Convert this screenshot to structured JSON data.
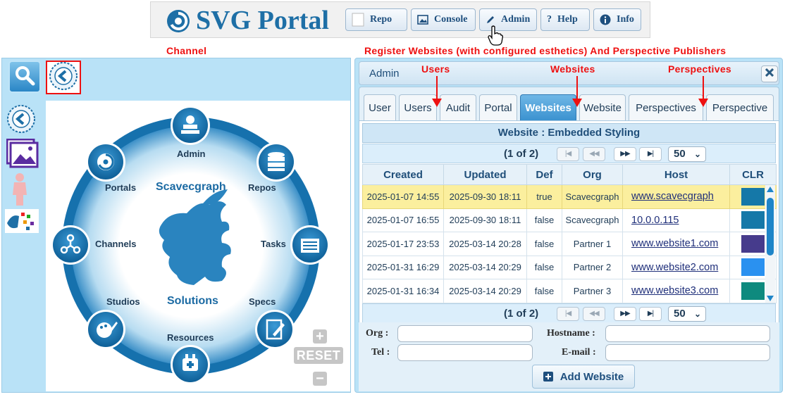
{
  "topbar": {
    "brand": "SVG Portal",
    "buttons": {
      "repo": "Repo",
      "console": "Console",
      "admin": "Admin",
      "help": "Help",
      "info": "Info"
    }
  },
  "annotations": {
    "channel": "Channel",
    "register": "Register Websites (with configured esthetics) And Perspective Publishers",
    "users": "Users",
    "websites": "Websites",
    "perspectives": "Perspectives"
  },
  "wheel": {
    "center_top": "Scavecgraph",
    "center_bottom": "Solutions",
    "nodes": {
      "admin": "Admin",
      "repos": "Repos",
      "tasks": "Tasks",
      "specs": "Specs",
      "resources": "Resources",
      "studios": "Studios",
      "channels": "Channels",
      "portals": "Portals"
    },
    "reset": "RESET"
  },
  "admin": {
    "title": "Admin",
    "tabs": [
      "User",
      "Users",
      "Audit",
      "Portal",
      "Websites",
      "Website",
      "Perspectives",
      "Perspective"
    ],
    "active_tab": "Websites",
    "grid": {
      "caption": "Website : Embedded Styling",
      "pager_info": "(1 of 2)",
      "page_size": "50",
      "columns": [
        "Created",
        "Updated",
        "Def",
        "Org",
        "Host",
        "CLR"
      ],
      "rows": [
        {
          "created": "2025-01-07 14:55",
          "updated": "2025-09-30 18:11",
          "def": "true",
          "org": "Scavecgraph",
          "host": "www.scavecgraph",
          "clr": "#1578a8"
        },
        {
          "created": "2025-01-07 16:55",
          "updated": "2025-09-30 18:11",
          "def": "false",
          "org": "Scavecgraph",
          "host": "10.0.0.115",
          "clr": "#1578a8"
        },
        {
          "created": "2025-01-17 23:53",
          "updated": "2025-03-14 20:28",
          "def": "false",
          "org": "Partner 1",
          "host": "www.website1.com",
          "clr": "#463b8c"
        },
        {
          "created": "2025-01-31 16:29",
          "updated": "2025-03-14 20:29",
          "def": "false",
          "org": "Partner 2",
          "host": "www.website2.com",
          "clr": "#2a91f0"
        },
        {
          "created": "2025-01-31 16:34",
          "updated": "2025-03-14 20:29",
          "def": "false",
          "org": "Partner 3",
          "host": "www.website3.com",
          "clr": "#0e8a7e"
        }
      ]
    },
    "form": {
      "org_label": "Org :",
      "hostname_label": "Hostname :",
      "tel_label": "Tel :",
      "email_label": "E-mail :",
      "add_button": "Add Website"
    }
  },
  "colors": {
    "brand": "#1e6fa6",
    "panel_bg": "#b9e2f7",
    "accent": "#3a91cf",
    "annotation": "#ee1111",
    "selected_row": "#fbef9e"
  }
}
